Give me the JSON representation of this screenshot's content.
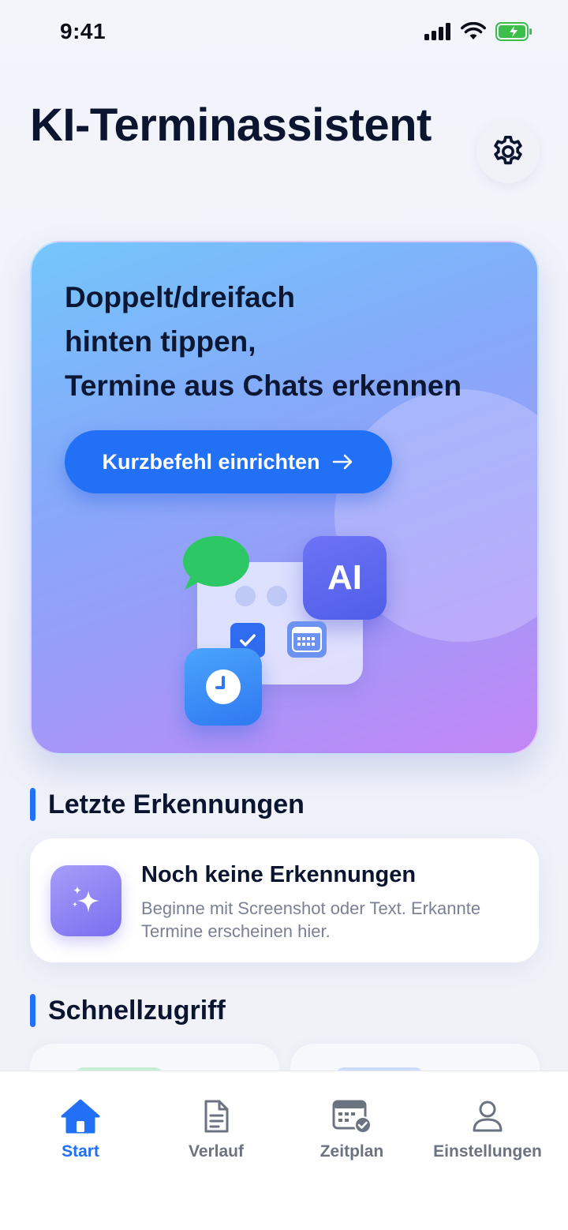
{
  "status_bar": {
    "time": "9:41"
  },
  "header": {
    "title": "KI-Terminassistent"
  },
  "hero": {
    "title_lines": [
      "Doppelt/dreifach",
      "hinten tippen,",
      "Termine aus Chats erkennen"
    ],
    "cta_label": "Kurzbefehl einrichten",
    "ai_badge": "AI"
  },
  "recent": {
    "heading": "Letzte Erkennungen",
    "empty_title": "Noch keine Erkennungen",
    "empty_description": "Beginne mit Screenshot oder Text. Erkannte Termine erscheinen hier."
  },
  "quick_access": {
    "heading": "Schnellzugriff"
  },
  "tabbar": {
    "tabs": [
      {
        "label": "Start",
        "icon": "home-icon",
        "active": true
      },
      {
        "label": "Verlauf",
        "icon": "document-icon",
        "active": false
      },
      {
        "label": "Zeitplan",
        "icon": "calendar-check-icon",
        "active": false
      },
      {
        "label": "Einstellungen",
        "icon": "person-icon",
        "active": false
      }
    ]
  },
  "colors": {
    "accent": "#2170F5",
    "text_primary": "#0B1530",
    "text_secondary": "#7A8194",
    "tab_inactive": "#6B7280"
  }
}
